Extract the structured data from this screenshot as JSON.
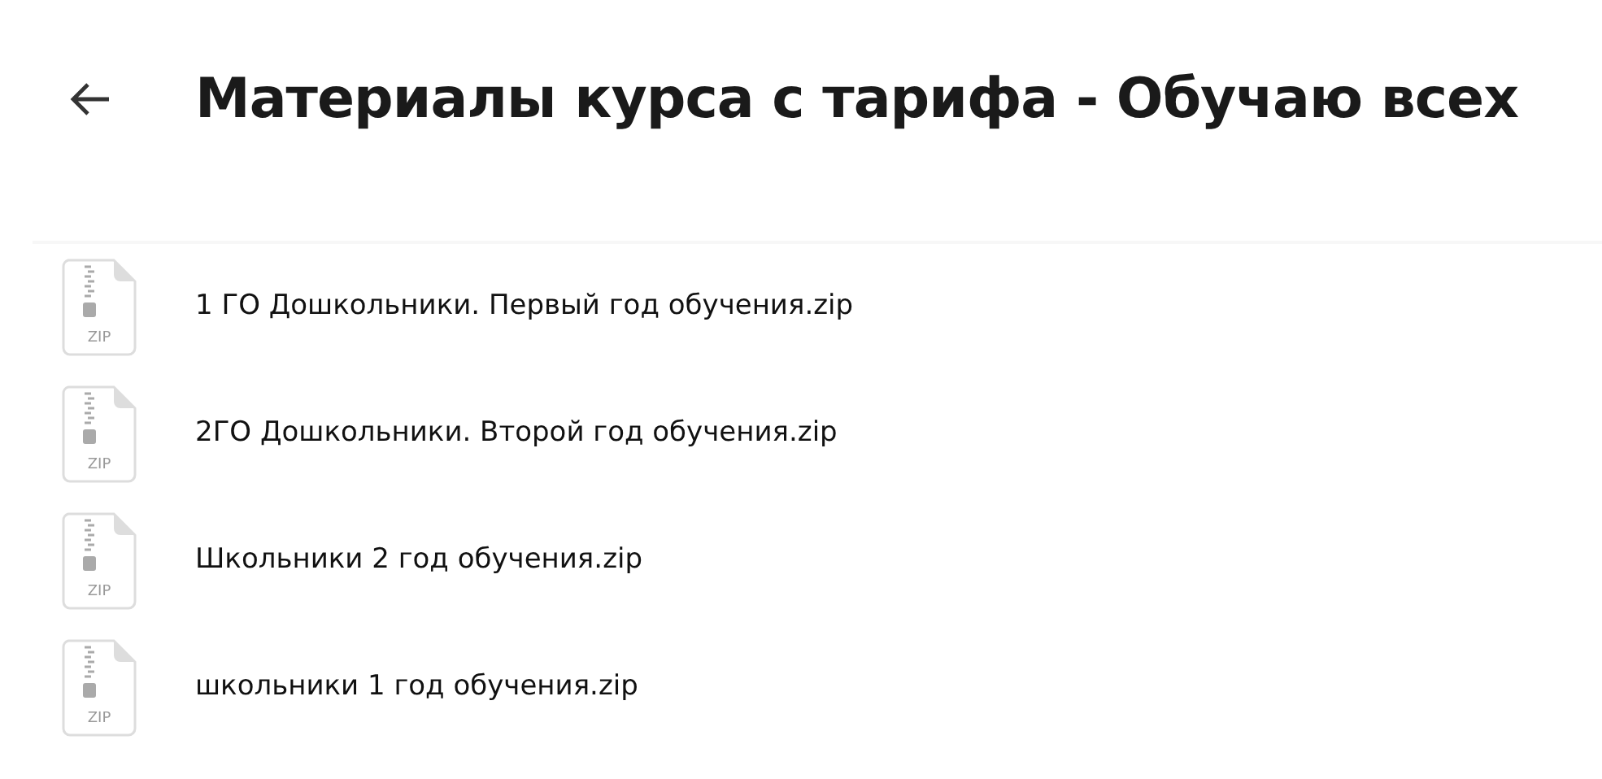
{
  "title": "Материалы курса с тарифа - Обучаю всех",
  "files": [
    {
      "name": "1 ГО Дошкольники. Первый год обучения.zip",
      "icon_label": "ZIP"
    },
    {
      "name": "2ГО Дошкольники. Второй год обучения.zip",
      "icon_label": "ZIP"
    },
    {
      "name": "Школьники 2 год обучения.zip",
      "icon_label": "ZIP"
    },
    {
      "name": "школьники 1 год обучения.zip",
      "icon_label": "ZIP"
    }
  ]
}
